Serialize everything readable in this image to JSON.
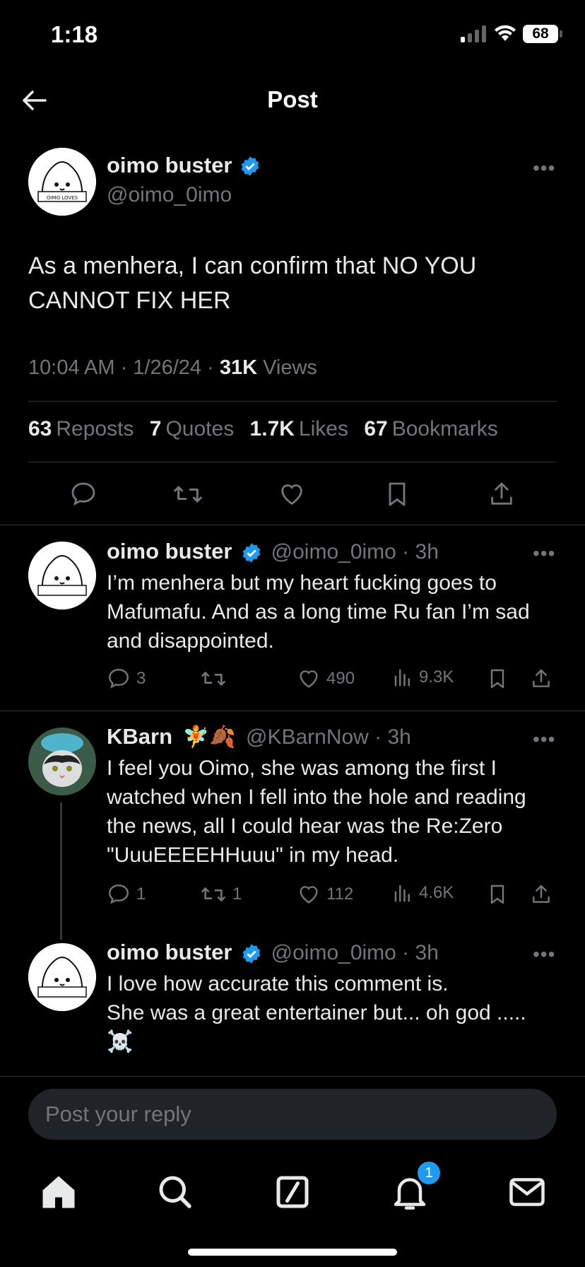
{
  "status": {
    "time": "1:18",
    "battery": "68"
  },
  "header": {
    "title": "Post"
  },
  "post": {
    "author": {
      "name": "oimo buster",
      "handle": "@oimo_0imo"
    },
    "text": "As a menhera, I can confirm that NO YOU CANNOT FIX HER",
    "timestamp": "10:04 AM · 1/26/24 · ",
    "views_count": "31K",
    "views_label": " Views",
    "stats": [
      {
        "count": "63",
        "label": "Reposts"
      },
      {
        "count": "7",
        "label": "Quotes"
      },
      {
        "count": "1.7K",
        "label": "Likes"
      },
      {
        "count": "67",
        "label": "Bookmarks"
      }
    ]
  },
  "replies": [
    {
      "name": "oimo buster",
      "handle": "@oimo_0imo · 3h",
      "text": "I’m menhera but my heart fucking goes to Mafumafu. And as a long time Ru fan I’m sad and disappointed.",
      "actions": {
        "replies": "3",
        "reposts": "",
        "likes": "490",
        "views": "9.3K"
      }
    },
    {
      "name": "KBarn",
      "emoji": "🧚🍂",
      "handle": "@KBarnNow · 3h",
      "text": "I feel you Oimo, she was among the first I watched when I fell into the hole and reading the news, all I could hear was the Re:Zero \"UuuEEEEHHuuu\" in my head.",
      "actions": {
        "replies": "1",
        "reposts": "1",
        "likes": "112",
        "views": "4.6K"
      }
    },
    {
      "name": "oimo buster",
      "handle": "@oimo_0imo · 3h",
      "text": "I love how accurate this comment is.\nShe was a great entertainer but... oh god .....\n☠️"
    }
  ],
  "composer": {
    "placeholder": "Post your reply"
  },
  "tabbar": {
    "notification_count": "1"
  },
  "colors": {
    "accent": "#1d9bf0",
    "background": "#000000",
    "muted": "#71767b"
  }
}
